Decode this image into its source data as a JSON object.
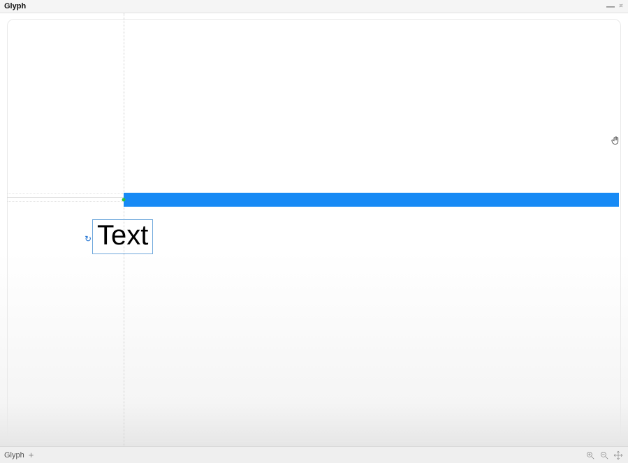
{
  "panel": {
    "title": "Glyph"
  },
  "footer": {
    "breadcrumb": "Glyph"
  },
  "canvas": {
    "text_object": {
      "content": "Text"
    },
    "colors": {
      "bar": "#178af5",
      "selection_border": "#6fa8dc",
      "snap_dot": "#2fbf3a"
    }
  }
}
